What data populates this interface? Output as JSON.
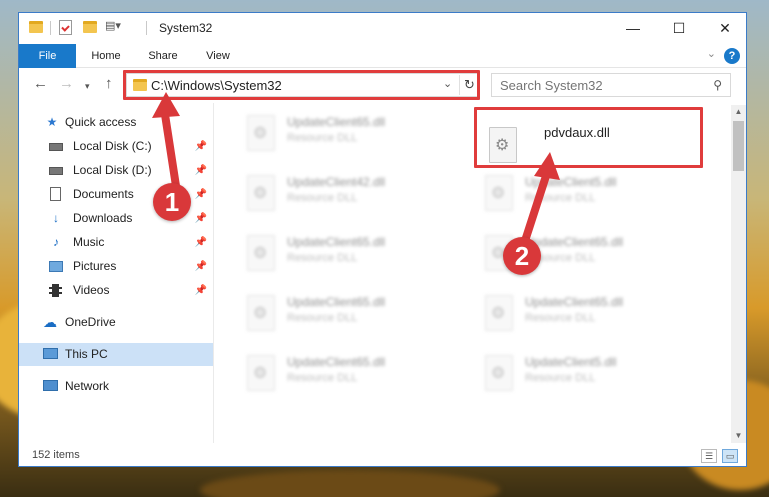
{
  "window": {
    "title": "System32",
    "controls": {
      "minimize": "—",
      "maximize": "☐",
      "close": "✕"
    }
  },
  "ribbon": {
    "tabs": [
      "File",
      "Home",
      "Share",
      "View"
    ],
    "help": "?"
  },
  "navbar": {
    "address": "C:\\Windows\\System32",
    "search_placeholder": "Search System32"
  },
  "sidebar": {
    "items": [
      {
        "label": "Quick access",
        "icon": "star-icon",
        "pinned": false
      },
      {
        "label": "Local Disk (C:)",
        "icon": "drive-icon",
        "pinned": true
      },
      {
        "label": "Local Disk (D:)",
        "icon": "drive-icon",
        "pinned": true
      },
      {
        "label": "Documents",
        "icon": "documents-icon",
        "pinned": true
      },
      {
        "label": "Downloads",
        "icon": "downloads-icon",
        "pinned": true
      },
      {
        "label": "Music",
        "icon": "music-icon",
        "pinned": true
      },
      {
        "label": "Pictures",
        "icon": "pictures-icon",
        "pinned": true
      },
      {
        "label": "Videos",
        "icon": "videos-icon",
        "pinned": true
      },
      {
        "label": "OneDrive",
        "icon": "cloud-icon",
        "pinned": false
      },
      {
        "label": "This PC",
        "icon": "computer-icon",
        "pinned": false,
        "selected": true
      },
      {
        "label": "Network",
        "icon": "network-icon",
        "pinned": false
      }
    ]
  },
  "files": {
    "left_column": [
      {
        "name": "UpdateClient65.dll",
        "type": "Resource DLL"
      },
      {
        "name": "UpdateClient42.dll",
        "type": "Resource DLL"
      },
      {
        "name": "UpdateClient65.dll",
        "type": "Resource DLL"
      },
      {
        "name": "UpdateClient65.dll",
        "type": "Resource DLL"
      },
      {
        "name": "UpdateClient65.dll",
        "type": "Resource DLL"
      }
    ],
    "right_column": [
      {
        "name": "pdvdaux.dll",
        "type": ""
      },
      {
        "name": "UpdateClient5.dll",
        "type": "Resource DLL"
      },
      {
        "name": "UpdateClient65.dll",
        "type": "Resource DLL"
      },
      {
        "name": "UpdateClient65.dll",
        "type": "Resource DLL"
      },
      {
        "name": "UpdateClient5.dll",
        "type": "Resource DLL"
      }
    ]
  },
  "status": {
    "item_count": "152 items"
  },
  "annotations": {
    "badge_1": "1",
    "badge_2": "2",
    "color": "#d9383a"
  }
}
